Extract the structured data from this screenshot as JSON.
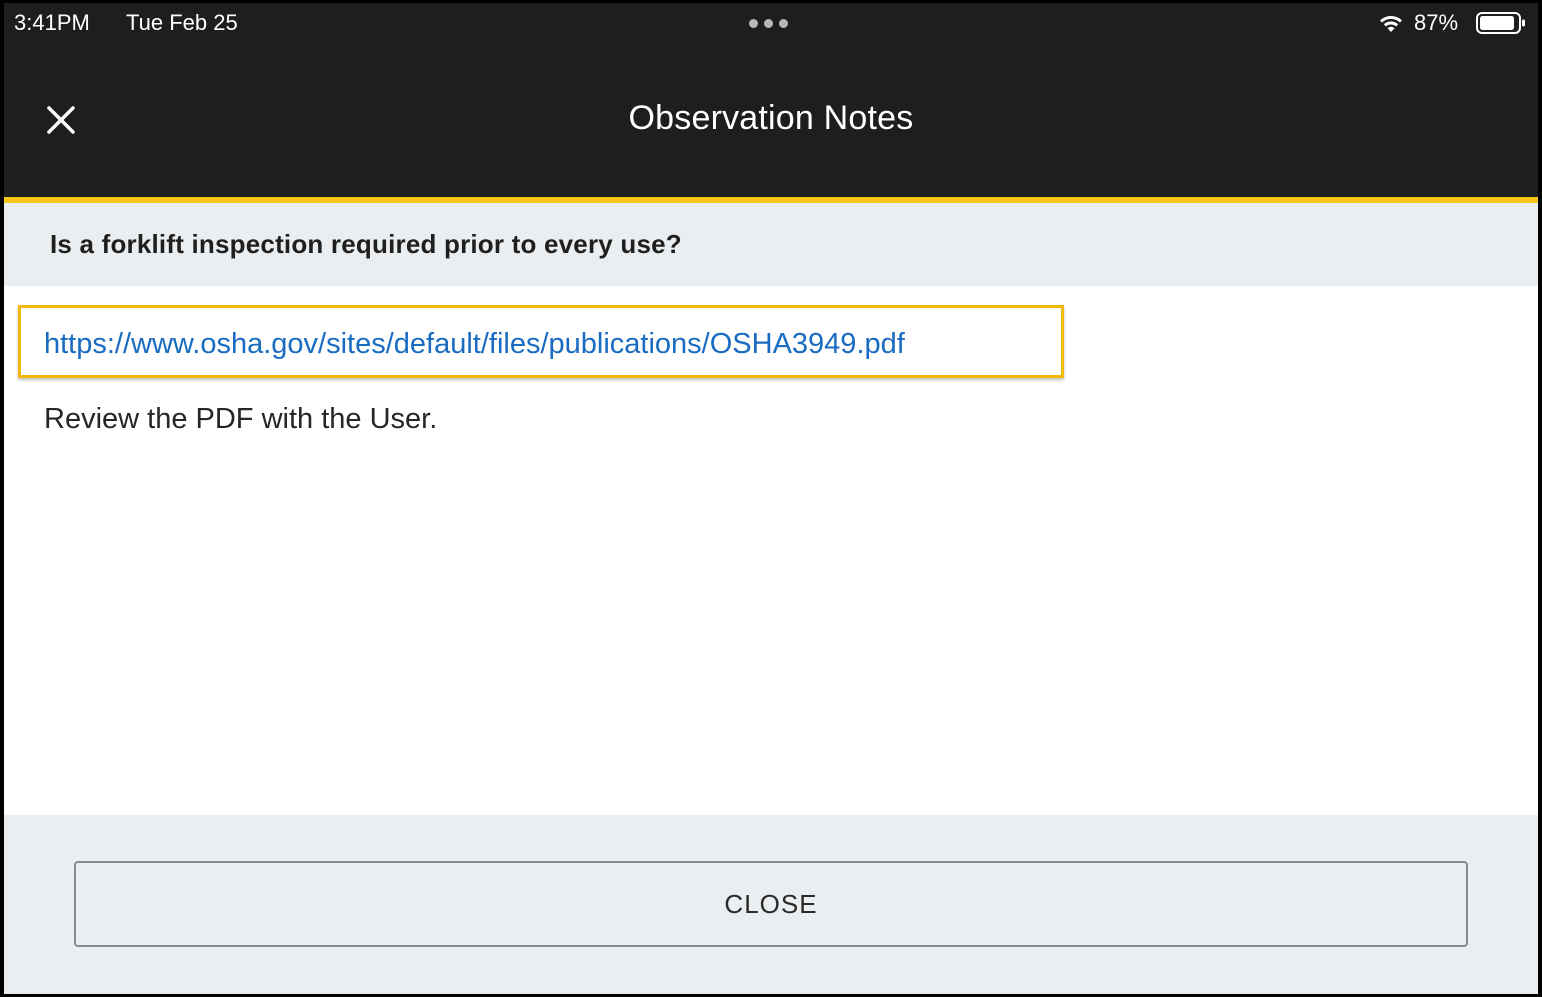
{
  "status_bar": {
    "time": "3:41PM",
    "date": "Tue Feb 25",
    "battery_percent": "87%",
    "icons": [
      "wifi-icon",
      "battery-icon",
      "more-dots-icon"
    ]
  },
  "header": {
    "title": "Observation Notes",
    "close_icon": "close-icon"
  },
  "question": {
    "text": "Is a forklift inspection required prior to every use?"
  },
  "notes": {
    "link": "https://www.osha.gov/sites/default/files/publications/OSHA3949.pdf",
    "text": "Review the PDF with the User."
  },
  "footer": {
    "close_label": "CLOSE"
  },
  "colors": {
    "header_bg": "#1e1e1e",
    "accent": "#f5c518",
    "link": "#1a6bc2",
    "band_bg": "#ebeef0"
  }
}
